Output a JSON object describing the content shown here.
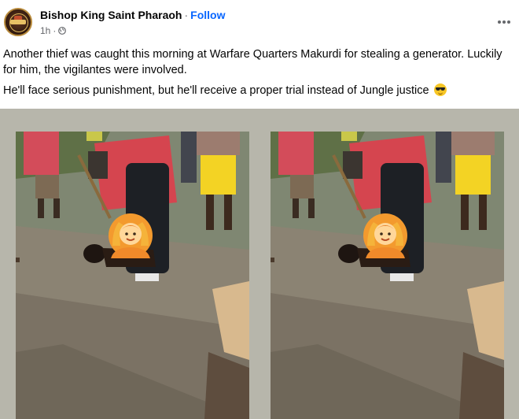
{
  "header": {
    "author": "Bishop King Saint Pharaoh",
    "separator": "·",
    "follow_label": "Follow",
    "timestamp": "1h",
    "meta_separator": "·",
    "audience_icon": "globe-icon",
    "more_icon": "more-options-icon"
  },
  "post": {
    "paragraph1": "Another thief was caught this morning at Warfare Quarters Makurdi for stealing a generator. Luckily for him, the vigilantes were involved.",
    "paragraph2": "He'll face serious punishment, but he'll receive a proper trial instead of Jungle justice",
    "paragraph2_emoji": "smiling-face-with-sunglasses-emoji"
  },
  "media": {
    "photos": [
      {
        "censor_emoji": "person-gesturing-ok-emoji"
      },
      {
        "censor_emoji": "person-gesturing-ok-emoji"
      }
    ],
    "background_color": "#b7b6ab"
  },
  "colors": {
    "accent": "#0866ff",
    "secondary_text": "#65676b"
  }
}
